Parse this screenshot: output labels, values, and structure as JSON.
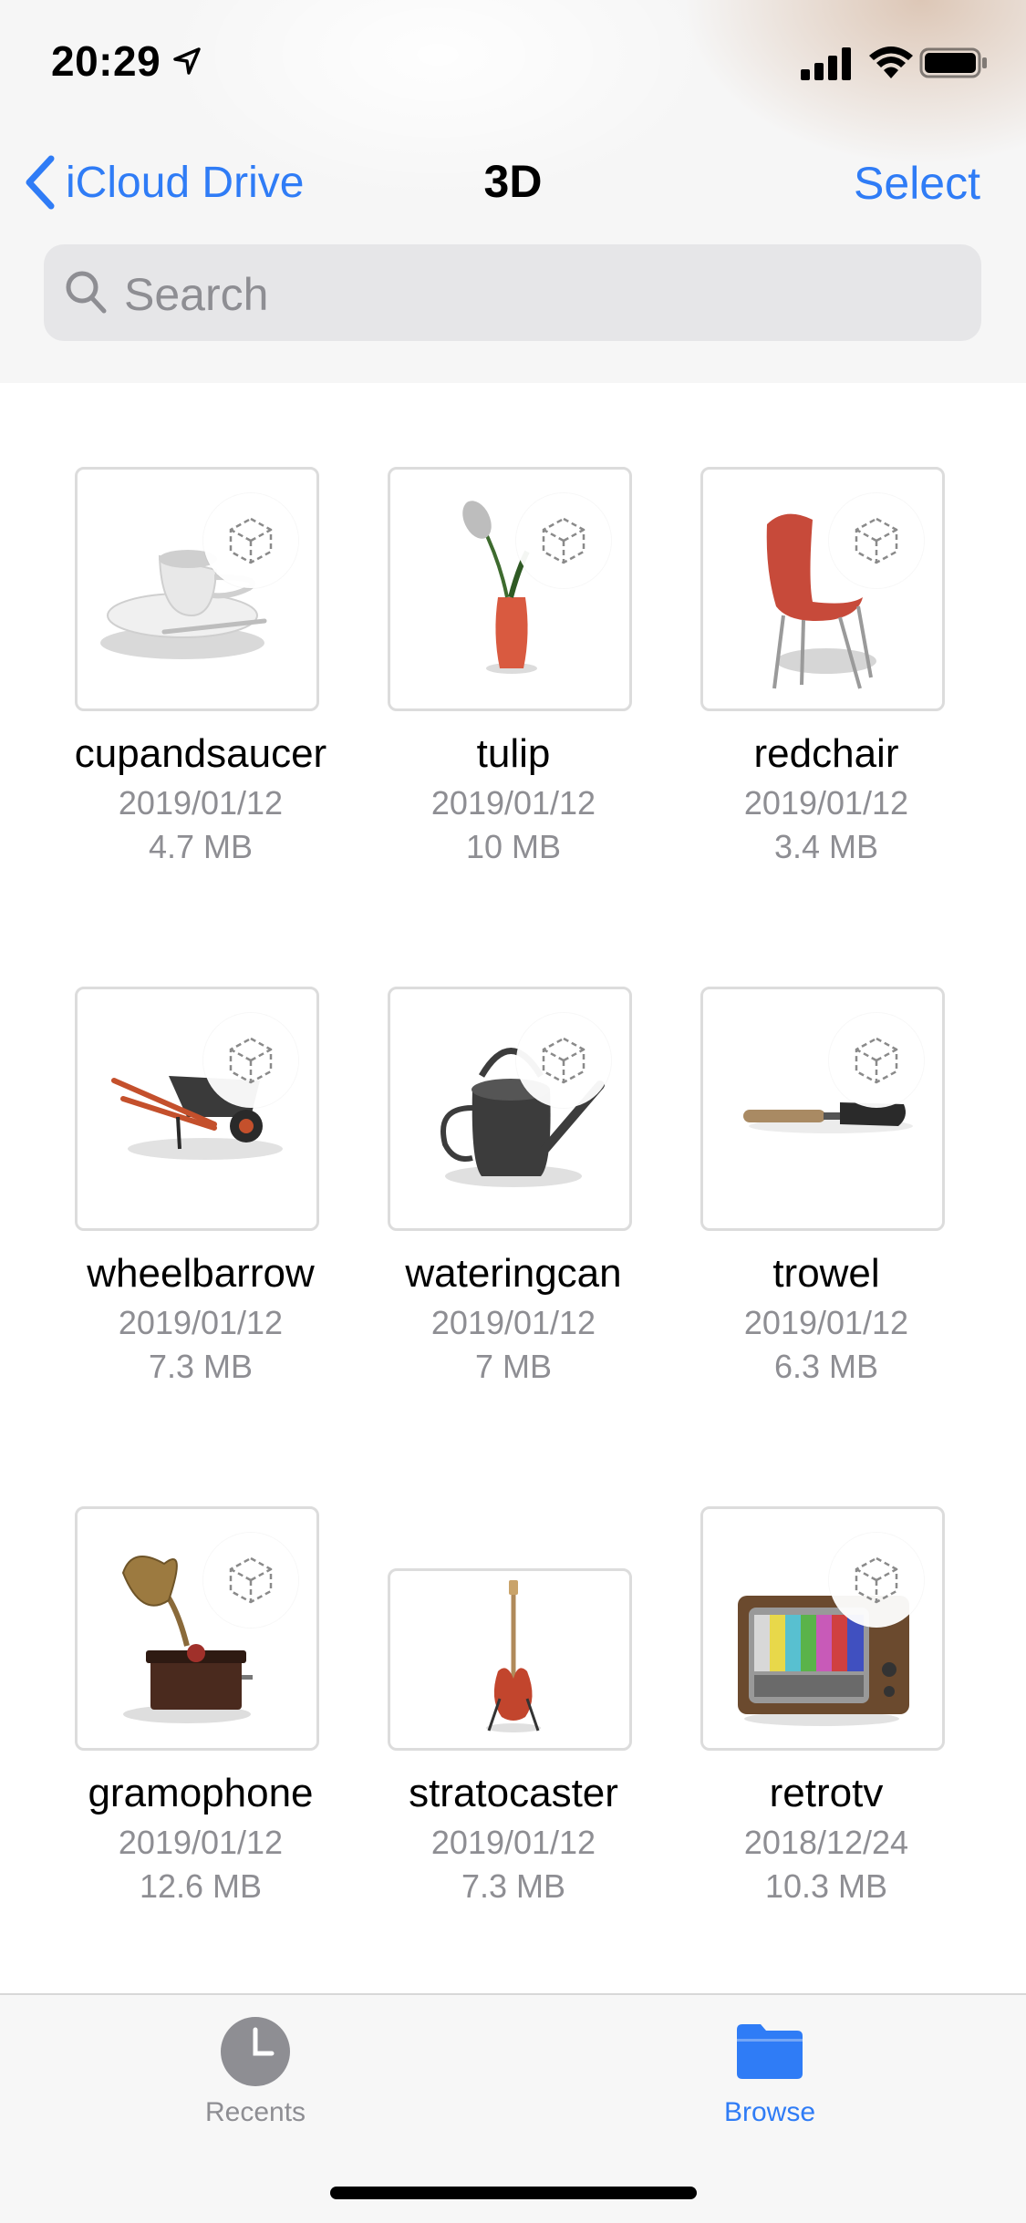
{
  "status_bar": {
    "time": "20:29"
  },
  "nav": {
    "back_label": "iCloud Drive",
    "title": "3D",
    "select_label": "Select"
  },
  "search": {
    "placeholder": "Search"
  },
  "files": [
    {
      "name": "cupandsaucer",
      "date": "2019/01/12",
      "size": "4.7 MB",
      "thumbnail": "cup-and-saucer"
    },
    {
      "name": "tulip",
      "date": "2019/01/12",
      "size": "10 MB",
      "thumbnail": "tulip-vase"
    },
    {
      "name": "redchair",
      "date": "2019/01/12",
      "size": "3.4 MB",
      "thumbnail": "red-chair"
    },
    {
      "name": "wheelbarrow",
      "date": "2019/01/12",
      "size": "7.3 MB",
      "thumbnail": "wheelbarrow"
    },
    {
      "name": "wateringcan",
      "date": "2019/01/12",
      "size": "7 MB",
      "thumbnail": "watering-can"
    },
    {
      "name": "trowel",
      "date": "2019/01/12",
      "size": "6.3 MB",
      "thumbnail": "trowel"
    },
    {
      "name": "gramophone",
      "date": "2019/01/12",
      "size": "12.6 MB",
      "thumbnail": "gramophone"
    },
    {
      "name": "stratocaster",
      "date": "2019/01/12",
      "size": "7.3 MB",
      "thumbnail": "guitar"
    },
    {
      "name": "retrotv",
      "date": "2018/12/24",
      "size": "10.3 MB",
      "thumbnail": "retro-tv"
    }
  ],
  "tab_bar": {
    "tabs": [
      {
        "label": "Recents",
        "icon": "clock-icon",
        "selected": false
      },
      {
        "label": "Browse",
        "icon": "folder-icon",
        "selected": true
      }
    ]
  },
  "colors": {
    "accent": "#2f7cf6",
    "secondary_text": "#8e8e93",
    "inactive_tab": "#8e8e93"
  }
}
